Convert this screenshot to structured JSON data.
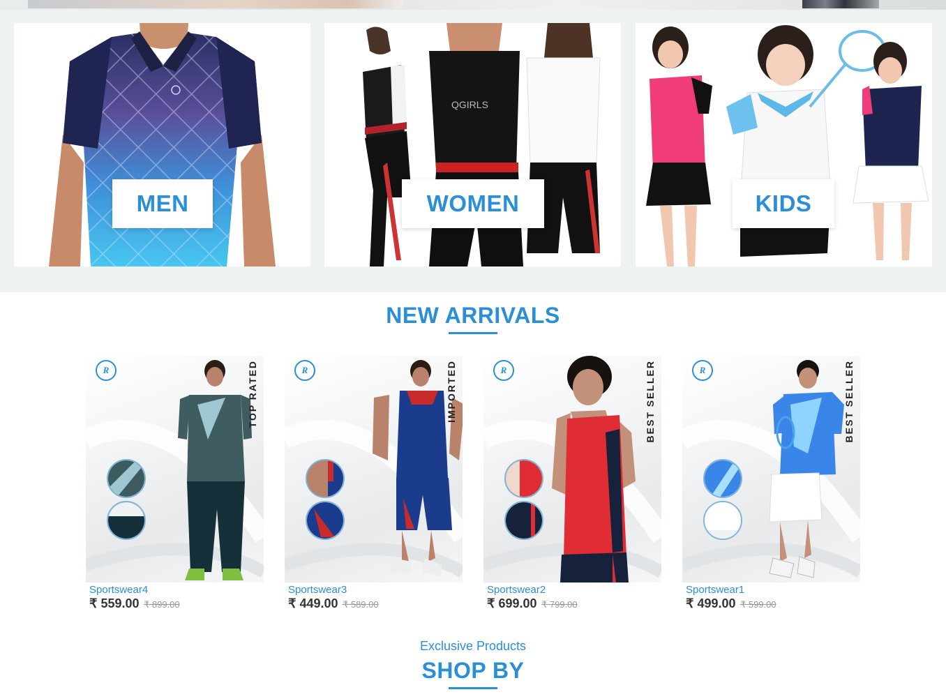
{
  "categories": [
    {
      "label": "MEN"
    },
    {
      "label": "WOMEN"
    },
    {
      "label": "KIDS"
    }
  ],
  "new_arrivals": {
    "title": "NEW ARRIVALS",
    "products": [
      {
        "name": "Sportswear4",
        "price": "₹ 559.00",
        "old_price": "₹ 899.00",
        "badge": "TOP RATED"
      },
      {
        "name": "Sportswear3",
        "price": "₹ 449.00",
        "old_price": "₹ 589.00",
        "badge": "IMPORTED"
      },
      {
        "name": "Sportswear2",
        "price": "₹ 699.00",
        "old_price": "₹ 799.00",
        "badge": "BEST SELLER"
      },
      {
        "name": "Sportswear1",
        "price": "₹ 499.00",
        "old_price": "₹ 599.00",
        "badge": "BEST SELLER"
      }
    ]
  },
  "shop_by": {
    "subtitle": "Exclusive Products",
    "title": "SHOP BY"
  },
  "colors": {
    "accent": "#2a8fd6",
    "band_background": "#eef2f1"
  }
}
